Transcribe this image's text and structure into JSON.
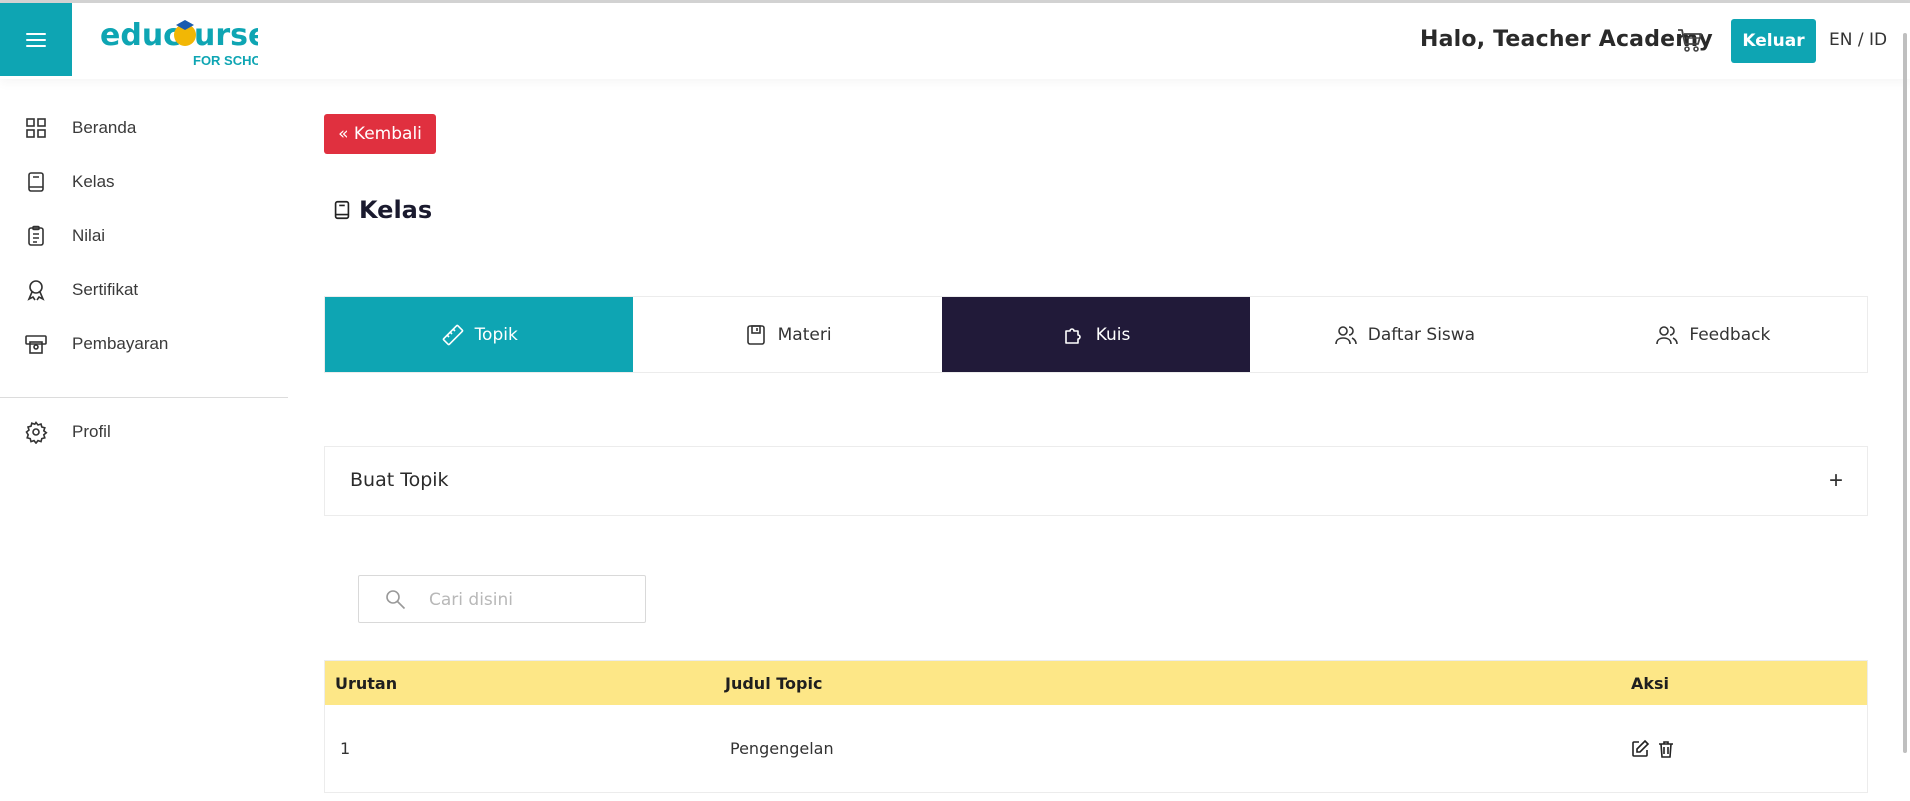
{
  "header": {
    "logo_text": "educourse",
    "logo_subtitle": "FOR SCHOOL",
    "greeting": "Halo, Teacher Academy",
    "logout_label": "Keluar",
    "lang_en": "EN",
    "lang_sep": " / ",
    "lang_id": "ID"
  },
  "sidebar": {
    "items": [
      {
        "label": "Beranda",
        "icon": "grid-icon"
      },
      {
        "label": "Kelas",
        "icon": "book-icon"
      },
      {
        "label": "Nilai",
        "icon": "clipboard-icon"
      },
      {
        "label": "Sertifikat",
        "icon": "award-icon"
      },
      {
        "label": "Pembayaran",
        "icon": "payment-icon"
      }
    ],
    "profile": {
      "label": "Profil",
      "icon": "gear-icon"
    }
  },
  "main": {
    "back_label": "« Kembali",
    "title": "Kelas",
    "tabs": [
      {
        "label": "Topik",
        "icon": "ruler-icon"
      },
      {
        "label": "Materi",
        "icon": "save-icon"
      },
      {
        "label": "Kuis",
        "icon": "puzzle-icon"
      },
      {
        "label": "Daftar Siswa",
        "icon": "users-icon"
      },
      {
        "label": "Feedback",
        "icon": "users-icon"
      }
    ],
    "accordion_label": "Buat Topik",
    "accordion_plus": "+",
    "search_placeholder": "Cari disini",
    "table": {
      "headers": [
        "Urutan",
        "Judul Topic",
        "Aksi"
      ],
      "rows": [
        {
          "order": "1",
          "title": "Pengengelan"
        }
      ]
    }
  },
  "colors": {
    "teal": "#0ea5b3",
    "dark": "#211a39",
    "red": "#e0303f",
    "table_header": "#fde787"
  }
}
